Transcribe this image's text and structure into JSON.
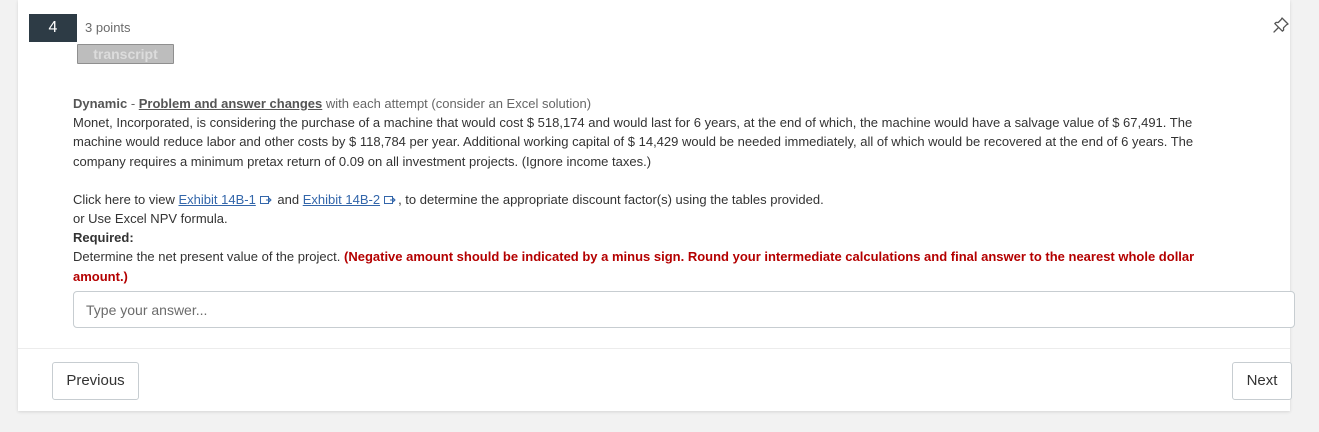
{
  "question": {
    "number": "4",
    "points": "3 points",
    "transcript_label": "transcript",
    "pin_icon": "pin-icon"
  },
  "body": {
    "dynamic_label": "Dynamic",
    "dash": " - ",
    "changes_link": "Problem and answer changes",
    "attempt_note": " with each attempt (consider an Excel solution)",
    "problem_line_1": "Monet, Incorporated, is considering the purchase of a machine that would cost $ 518,174 and would last for 6 years, at the end of which, the machine would have a salvage value of $ 67,491. The",
    "problem_line_2": "machine would reduce labor and other costs by $ 118,784 per year. Additional working capital of $ 14,429 would be needed immediately, all of which would be recovered at the end of 6 years. The",
    "problem_line_3": "company requires a minimum pretax return of 0.09 on all investment projects. (Ignore income taxes.)",
    "click_prefix": "Click here to view ",
    "exhibit_1": "Exhibit 14B-1",
    "and_text": " and ",
    "exhibit_2": "Exhibit 14B-2",
    "click_suffix": ", to determine the appropriate discount factor(s) using the tables provided.",
    "excel_line": " or Use Excel  NPV formula.",
    "required_label": "Required:",
    "instruction": "Determine the net present value of the project. ",
    "red_line_1": "(Negative amount should be indicated by a minus sign. Round your intermediate calculations and final answer to the nearest whole dollar",
    "red_line_2": "amount.)"
  },
  "answer": {
    "value": "",
    "placeholder": "Type your answer..."
  },
  "navigation": {
    "previous_label": "Previous",
    "next_label": "Next"
  },
  "colors": {
    "badge_bg": "#2d3b45",
    "link": "#3366aa",
    "warning_red": "#b40000",
    "page_bg": "#f2f2f2"
  }
}
